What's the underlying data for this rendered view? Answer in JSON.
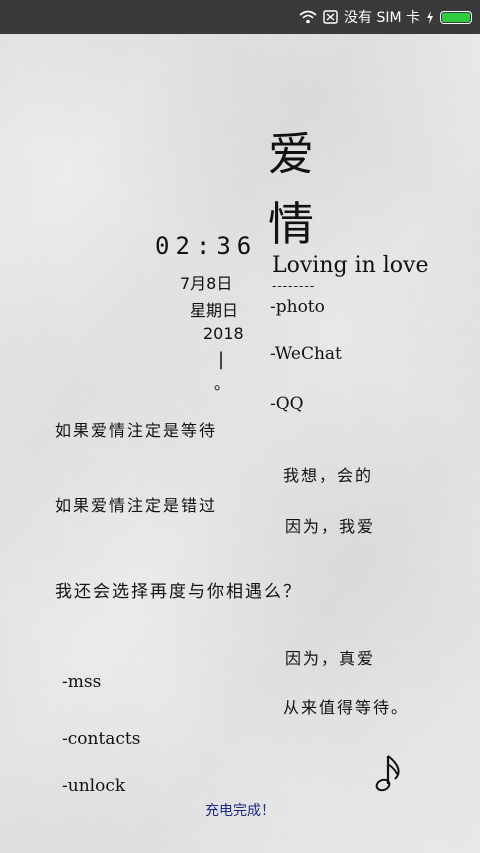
{
  "status_bar": {
    "wifi_icon": "wifi-icon",
    "sim_icon": "sim-card-icon",
    "sim_text": "没有 SIM 卡",
    "charging_icon": "lightning-bolt-icon",
    "battery_level": 1.0,
    "battery_color": "#2ecc40"
  },
  "title": {
    "char1": "爱",
    "char2": "情"
  },
  "subtitle": "Loving in love",
  "divider": "--------",
  "menu_right": [
    "-photo",
    "-WeChat",
    "-QQ"
  ],
  "clock": {
    "time": "02:36",
    "date": "7月8日",
    "weekday": "星期日",
    "year": "2018",
    "bar": "|",
    "dot": "。"
  },
  "poem_left": [
    "如果爱情注定是等待",
    "如果爱情注定是错过",
    "我还会选择再度与你相遇么？"
  ],
  "poem_right": [
    "我想，会的",
    "因为，我爱",
    "因为，真爱",
    "从来值得等待。"
  ],
  "menu_left": [
    "-mss",
    "-contacts",
    "-unlock"
  ],
  "music_icon": "music-note-icon",
  "charging_status": "充电完成！",
  "colors": {
    "status_bar_bg": "#3a3a3a",
    "charging_text": "#1a2a8a"
  }
}
